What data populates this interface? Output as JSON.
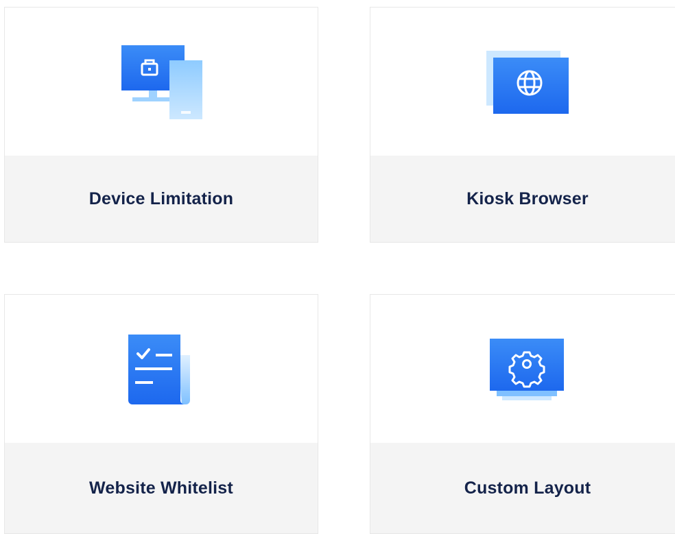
{
  "features": [
    {
      "label": "Device Limitation",
      "icon": "devices-briefcase-icon"
    },
    {
      "label": "Kiosk Browser",
      "icon": "globe-window-icon"
    },
    {
      "label": "Website Whitelist",
      "icon": "checklist-document-icon"
    },
    {
      "label": "Custom Layout",
      "icon": "gear-monitor-icon"
    }
  ],
  "colors": {
    "accent_dark": "#1f6ff0",
    "accent_light": "#6fb7ff",
    "accent_pale": "#cfe8ff",
    "label_text": "#14234a",
    "label_bg": "#f4f4f4"
  }
}
